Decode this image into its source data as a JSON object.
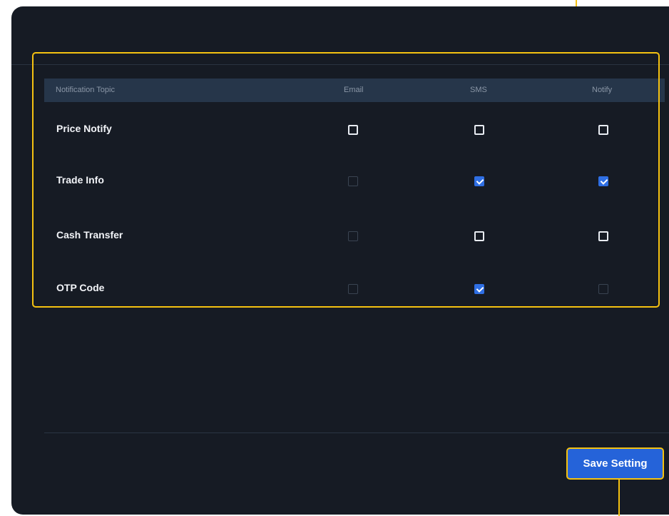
{
  "table": {
    "headers": {
      "topic": "Notification Topic",
      "email": "Email",
      "sms": "SMS",
      "notify": "Notify"
    },
    "rows": [
      {
        "label": "Price Notify",
        "email": "unchecked",
        "sms": "unchecked",
        "notify": "unchecked"
      },
      {
        "label": "Trade Info",
        "email": "disabled",
        "sms": "checked",
        "notify": "checked"
      },
      {
        "label": "Cash Transfer",
        "email": "disabled",
        "sms": "unchecked",
        "notify": "unchecked"
      },
      {
        "label": "OTP Code",
        "email": "disabled",
        "sms": "checked",
        "notify": "disabled"
      }
    ]
  },
  "footer": {
    "save_label": "Save Setting"
  },
  "colors": {
    "panel_bg": "#161b24",
    "header_bg": "#26364a",
    "accent": "#2563d9",
    "highlight": "#f5c211"
  }
}
